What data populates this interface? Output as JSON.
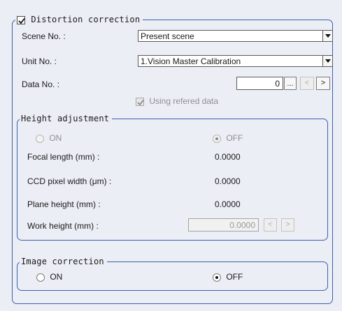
{
  "distortion": {
    "title": "Distortion correction",
    "checked": true,
    "scene": {
      "label": "Scene No. :",
      "value": "Present scene"
    },
    "unit": {
      "label": "Unit No. :",
      "value": "1.Vision Master Calibration"
    },
    "data": {
      "label": "Data No. :",
      "value": "0",
      "ellipsis": "...",
      "prev": "<",
      "next": ">"
    },
    "using_refered": {
      "label": "Using refered data",
      "checked": true
    }
  },
  "height_adjustment": {
    "title": "Height adjustment",
    "on_label": "ON",
    "off_label": "OFF",
    "selected": "OFF",
    "rows": [
      {
        "label": "Focal length (mm) :",
        "value": "0.0000"
      },
      {
        "label": "CCD pixel width (μm) :",
        "value": "0.0000"
      },
      {
        "label": "Plane height (mm) :",
        "value": "0.0000"
      }
    ],
    "work_height": {
      "label": "Work height (mm) :",
      "value": "0.0000",
      "prev": "<",
      "next": ">"
    }
  },
  "image_correction": {
    "title": "Image correction",
    "on_label": "ON",
    "off_label": "OFF",
    "selected": "OFF"
  }
}
